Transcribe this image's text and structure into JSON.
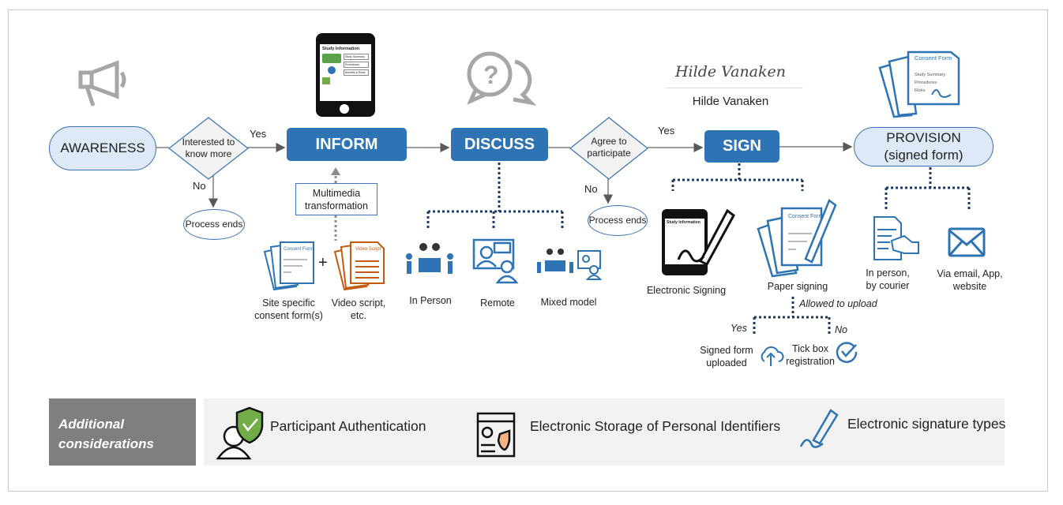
{
  "flow": {
    "awareness": "AWARENESS",
    "decision1": "Interested to know more",
    "yes1": "Yes",
    "no1": "No",
    "process_ends1": "Process ends",
    "inform": "INFORM",
    "discuss": "DISCUSS",
    "decision2": "Agree to participate",
    "yes2": "Yes",
    "no2": "No",
    "process_ends2": "Process ends",
    "sign": "SIGN",
    "provision_line1": "PROVISION",
    "provision_line2": "(signed form)"
  },
  "inform_detail": {
    "phone_title": "Study Information",
    "phone_buttons": [
      "Study Summary",
      "Procedures",
      "Benefits & Risks"
    ],
    "multimedia": "Multimedia transformation",
    "consent_label": "Site specific consent form(s)",
    "plus": "+",
    "video_label": "Video script, etc.",
    "video_doc_title": "Video Script",
    "consent_doc_title": "Consent Form",
    "consent_doc_items": [
      "Study Summary",
      "Procedures",
      "Risks"
    ]
  },
  "discuss_options": [
    "In Person",
    "Remote",
    "Mixed model"
  ],
  "signature": {
    "script": "Hilde Vanaken",
    "printed": "Hilde Vanaken"
  },
  "sign_options": {
    "electronic": "Electronic Signing",
    "paper": "Paper signing",
    "allowed": "Allowed to upload",
    "yes": "Yes",
    "no": "No",
    "uploaded": "Signed form uploaded",
    "tickbox": "Tick box registration"
  },
  "provision_options": [
    "In person, by courier",
    "Via email, App, website"
  ],
  "considerations": {
    "heading": "Additional considerations",
    "items": [
      "Participant Authentication",
      "Electronic Storage of Personal Identifiers",
      "Electronic signature types"
    ]
  },
  "colors": {
    "primary": "#2e74b5",
    "pill_fill": "#dde9f6",
    "outline": "#3a6fb0",
    "dotted": "#1f3864",
    "gray_box": "#7f7f7f",
    "panel": "#f2f2f2"
  }
}
